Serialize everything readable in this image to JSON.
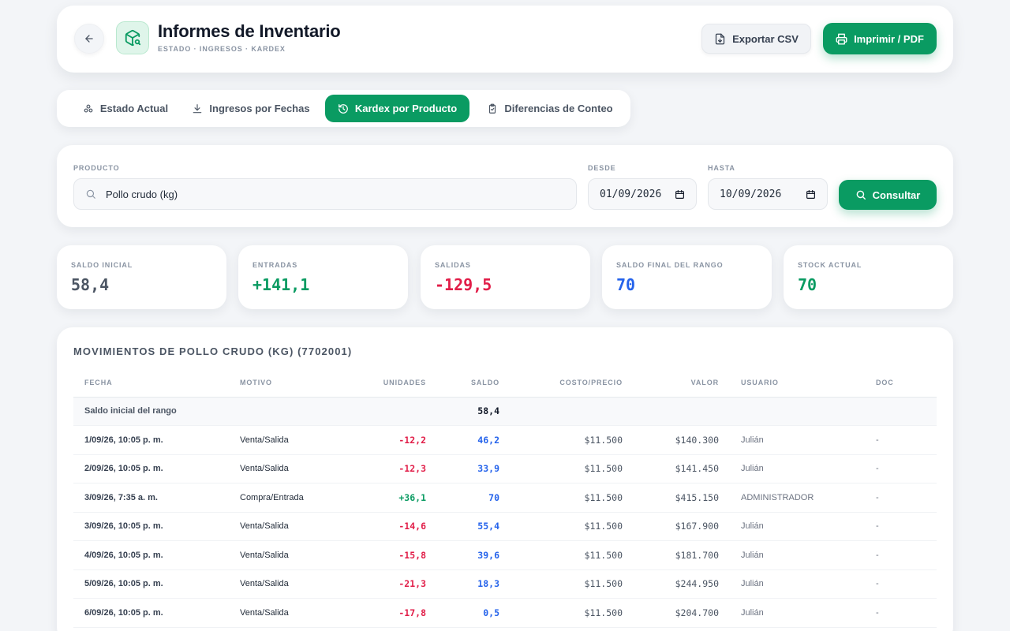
{
  "header": {
    "title": "Informes de Inventario",
    "subtitle": "ESTADO · INGRESOS · KARDEX",
    "export_label": "Exportar CSV",
    "print_label": "Imprimir / PDF"
  },
  "tabs": [
    {
      "label": "Estado Actual",
      "icon": "layers-icon",
      "active": false
    },
    {
      "label": "Ingresos por Fechas",
      "icon": "download-icon",
      "active": false
    },
    {
      "label": "Kardex por Producto",
      "icon": "history-icon",
      "active": true
    },
    {
      "label": "Diferencias de Conteo",
      "icon": "clipboard-icon",
      "active": false
    }
  ],
  "filters": {
    "product_label": "PRODUCTO",
    "product_value": "Pollo crudo (kg)",
    "from_label": "DESDE",
    "from_value": "01/09/2026",
    "to_label": "HASTA",
    "to_value": "10/09/2026",
    "query_label": "Consultar"
  },
  "stats": [
    {
      "label": "SALDO INICIAL",
      "value": "58,4"
    },
    {
      "label": "ENTRADAS",
      "value": "+141,1"
    },
    {
      "label": "SALIDAS",
      "value": "-129,5"
    },
    {
      "label": "SALDO FINAL DEL RANGO",
      "value": "70"
    },
    {
      "label": "STOCK ACTUAL",
      "value": "70"
    }
  ],
  "colors": {
    "accent": "#0a9b62",
    "negative": "#e11d48",
    "balance": "#2563eb",
    "neutral": "#4b5563"
  },
  "table": {
    "title": "MOVIMIENTOS DE POLLO CRUDO (KG) (7702001)",
    "headers": {
      "fecha": "FECHA",
      "motivo": "MOTIVO",
      "unidades": "UNIDADES",
      "saldo": "SALDO",
      "costo": "COSTO/PRECIO",
      "valor": "VALOR",
      "usuario": "USUARIO",
      "doc": "DOC"
    },
    "initial_label": "Saldo inicial del rango",
    "initial_balance": "58,4",
    "rows": [
      {
        "fecha": "1/09/26, 10:05 p. m.",
        "motivo": "Venta/Salida",
        "unidades": "-12,2",
        "saldo": "46,2",
        "costo": "$11.500",
        "valor": "$140.300",
        "usuario": "Julián",
        "doc": "-"
      },
      {
        "fecha": "2/09/26, 10:05 p. m.",
        "motivo": "Venta/Salida",
        "unidades": "-12,3",
        "saldo": "33,9",
        "costo": "$11.500",
        "valor": "$141.450",
        "usuario": "Julián",
        "doc": "-"
      },
      {
        "fecha": "3/09/26, 7:35 a. m.",
        "motivo": "Compra/Entrada",
        "unidades": "+36,1",
        "saldo": "70",
        "costo": "$11.500",
        "valor": "$415.150",
        "usuario": "ADMINISTRADOR",
        "doc": "-"
      },
      {
        "fecha": "3/09/26, 10:05 p. m.",
        "motivo": "Venta/Salida",
        "unidades": "-14,6",
        "saldo": "55,4",
        "costo": "$11.500",
        "valor": "$167.900",
        "usuario": "Julián",
        "doc": "-"
      },
      {
        "fecha": "4/09/26, 10:05 p. m.",
        "motivo": "Venta/Salida",
        "unidades": "-15,8",
        "saldo": "39,6",
        "costo": "$11.500",
        "valor": "$181.700",
        "usuario": "Julián",
        "doc": "-"
      },
      {
        "fecha": "5/09/26, 10:05 p. m.",
        "motivo": "Venta/Salida",
        "unidades": "-21,3",
        "saldo": "18,3",
        "costo": "$11.500",
        "valor": "$244.950",
        "usuario": "Julián",
        "doc": "-"
      },
      {
        "fecha": "6/09/26, 10:05 p. m.",
        "motivo": "Venta/Salida",
        "unidades": "-17,8",
        "saldo": "0,5",
        "costo": "$11.500",
        "valor": "$204.700",
        "usuario": "Julián",
        "doc": "-"
      }
    ]
  }
}
